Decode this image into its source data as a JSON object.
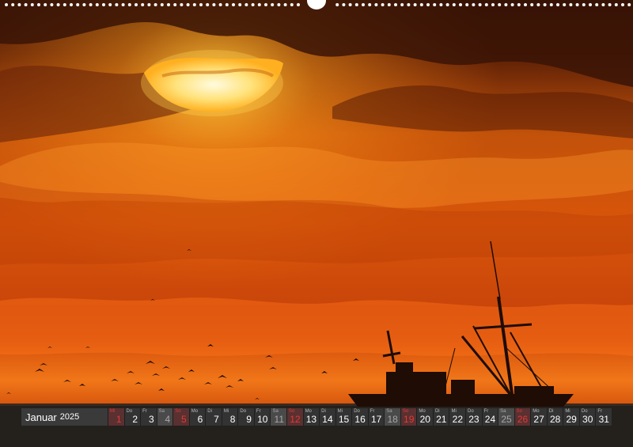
{
  "calendar": {
    "month": "Januar",
    "year": "2025",
    "days": [
      {
        "name": "Mi",
        "num": "1",
        "kind": "holiday"
      },
      {
        "name": "Do",
        "num": "2",
        "kind": "weekday"
      },
      {
        "name": "Fr",
        "num": "3",
        "kind": "weekday"
      },
      {
        "name": "Sa",
        "num": "4",
        "kind": "saturday"
      },
      {
        "name": "So",
        "num": "5",
        "kind": "sunday"
      },
      {
        "name": "Mo",
        "num": "6",
        "kind": "weekday"
      },
      {
        "name": "Di",
        "num": "7",
        "kind": "weekday"
      },
      {
        "name": "Mi",
        "num": "8",
        "kind": "weekday"
      },
      {
        "name": "Do",
        "num": "9",
        "kind": "weekday"
      },
      {
        "name": "Fr",
        "num": "10",
        "kind": "weekday"
      },
      {
        "name": "Sa",
        "num": "11",
        "kind": "saturday"
      },
      {
        "name": "So",
        "num": "12",
        "kind": "sunday"
      },
      {
        "name": "Mo",
        "num": "13",
        "kind": "weekday"
      },
      {
        "name": "Di",
        "num": "14",
        "kind": "weekday"
      },
      {
        "name": "Mi",
        "num": "15",
        "kind": "weekday"
      },
      {
        "name": "Do",
        "num": "16",
        "kind": "weekday"
      },
      {
        "name": "Fr",
        "num": "17",
        "kind": "weekday"
      },
      {
        "name": "Sa",
        "num": "18",
        "kind": "saturday"
      },
      {
        "name": "So",
        "num": "19",
        "kind": "sunday"
      },
      {
        "name": "Mo",
        "num": "20",
        "kind": "weekday"
      },
      {
        "name": "Di",
        "num": "21",
        "kind": "weekday"
      },
      {
        "name": "Mi",
        "num": "22",
        "kind": "weekday"
      },
      {
        "name": "Do",
        "num": "23",
        "kind": "weekday"
      },
      {
        "name": "Fr",
        "num": "24",
        "kind": "weekday"
      },
      {
        "name": "Sa",
        "num": "25",
        "kind": "saturday"
      },
      {
        "name": "So",
        "num": "26",
        "kind": "sunday"
      },
      {
        "name": "Mo",
        "num": "27",
        "kind": "weekday"
      },
      {
        "name": "Di",
        "num": "28",
        "kind": "weekday"
      },
      {
        "name": "Mi",
        "num": "29",
        "kind": "weekday"
      },
      {
        "name": "Do",
        "num": "30",
        "kind": "weekday"
      },
      {
        "name": "Fr",
        "num": "31",
        "kind": "weekday"
      }
    ]
  },
  "colors": {
    "sky_top": "#2a0f04",
    "sky_mid": "#e0560a",
    "sky_glow": "#ff8a1a",
    "sun": "#fff3b0",
    "sea": "#24201c",
    "sunday_text": "#e03a3a"
  },
  "icons": [
    "sun-icon",
    "fishing-boat-icon",
    "seagull-icon",
    "binding-ring-icon"
  ]
}
